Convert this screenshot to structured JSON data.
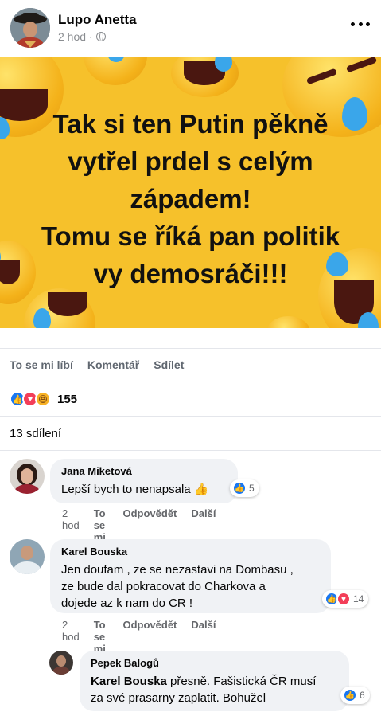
{
  "post": {
    "author": "Lupo Anetta",
    "time": "2 hod",
    "separator": "·",
    "image_text_lines": [
      "Tak si ten Putin pěkně",
      "vytřel prdel s celým",
      "západem!",
      "Tomu se říká pan politik",
      "vy demosráči!!!"
    ]
  },
  "actions": {
    "like": "To se mi líbí",
    "comment": "Komentář",
    "share": "Sdílet"
  },
  "reactions": {
    "count": "155"
  },
  "shares": "13 sdílení",
  "comments": [
    {
      "name": "Jana Miketová",
      "text": "Lepší bych to nenapsala 👍",
      "time": "2 hod",
      "like": "To se mi líbí",
      "reply": "Odpovědět",
      "more": "Další",
      "reaction_count": "5"
    },
    {
      "name": "Karel Bouska",
      "text_lines": [
        "Jen doufam , ze se nezastavi na Dombasu ,",
        "ze bude dal pokracovat do Charkova a",
        "dojede az k nam do CR !"
      ],
      "time": "2 hod",
      "like": "To se mi líbí",
      "reply": "Odpovědět",
      "more": "Další",
      "reaction_count": "14"
    },
    {
      "name": "Pepek Balogů",
      "mention": "Karel Bouska",
      "text_line1": " přesně. Fašistická ČR musí",
      "text_line2": "za své prasarny zaplatit. Bohužel",
      "reaction_count": "6"
    }
  ],
  "colors": {
    "image_bg": "#f6c12b",
    "like_blue": "#1877f2",
    "love_red": "#f33e58",
    "bubble": "#f0f2f5",
    "muted": "#65676b"
  }
}
